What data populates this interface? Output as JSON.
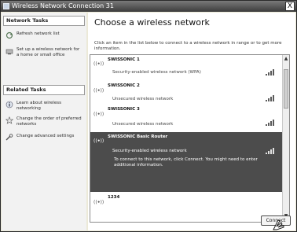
{
  "window": {
    "title": "Wireless Network Connection 31",
    "close_label": "X"
  },
  "sidebar": {
    "network_tasks_header": "Network Tasks",
    "network_tasks": [
      {
        "label": "Refresh network list",
        "icon": "refresh-icon"
      },
      {
        "label": "Set up a wireless network for a home or small office",
        "icon": "setup-network-icon"
      }
    ],
    "related_tasks_header": "Related Tasks",
    "related_tasks": [
      {
        "label": "Learn about wireless networking",
        "icon": "info-icon"
      },
      {
        "label": "Change the order of preferred networks",
        "icon": "star-icon"
      },
      {
        "label": "Change advanced settings",
        "icon": "settings-icon"
      }
    ]
  },
  "main": {
    "title": "Choose a wireless network",
    "description": "Click an item in the list below to connect to a wireless network in range or to get more information.",
    "networks": [
      {
        "index": "1",
        "name": "SWISSONIC 1",
        "status": "Security-enabled wireless network (WPA)",
        "secured": true,
        "signal": 4,
        "selected": false
      },
      {
        "index": "2",
        "name": "SWISSONIC 2",
        "status": "Unsecured wireless network",
        "secured": false,
        "signal": 4,
        "selected": false
      },
      {
        "index": "3",
        "name": "SWISSONIC 3",
        "status": "Unsecured wireless network",
        "secured": false,
        "signal": 4,
        "selected": false
      },
      {
        "index": "4",
        "name": "SWISSONIC Basic Router",
        "status": "Security-enabled wireless network",
        "secured": true,
        "signal": 4,
        "selected": true,
        "message": "To connect to this network, click Connect. You might need to enter additional information."
      },
      {
        "index": "5",
        "name": "1234",
        "status": "",
        "secured": false,
        "signal": 0,
        "selected": false
      }
    ],
    "connect_label": "Connect"
  }
}
